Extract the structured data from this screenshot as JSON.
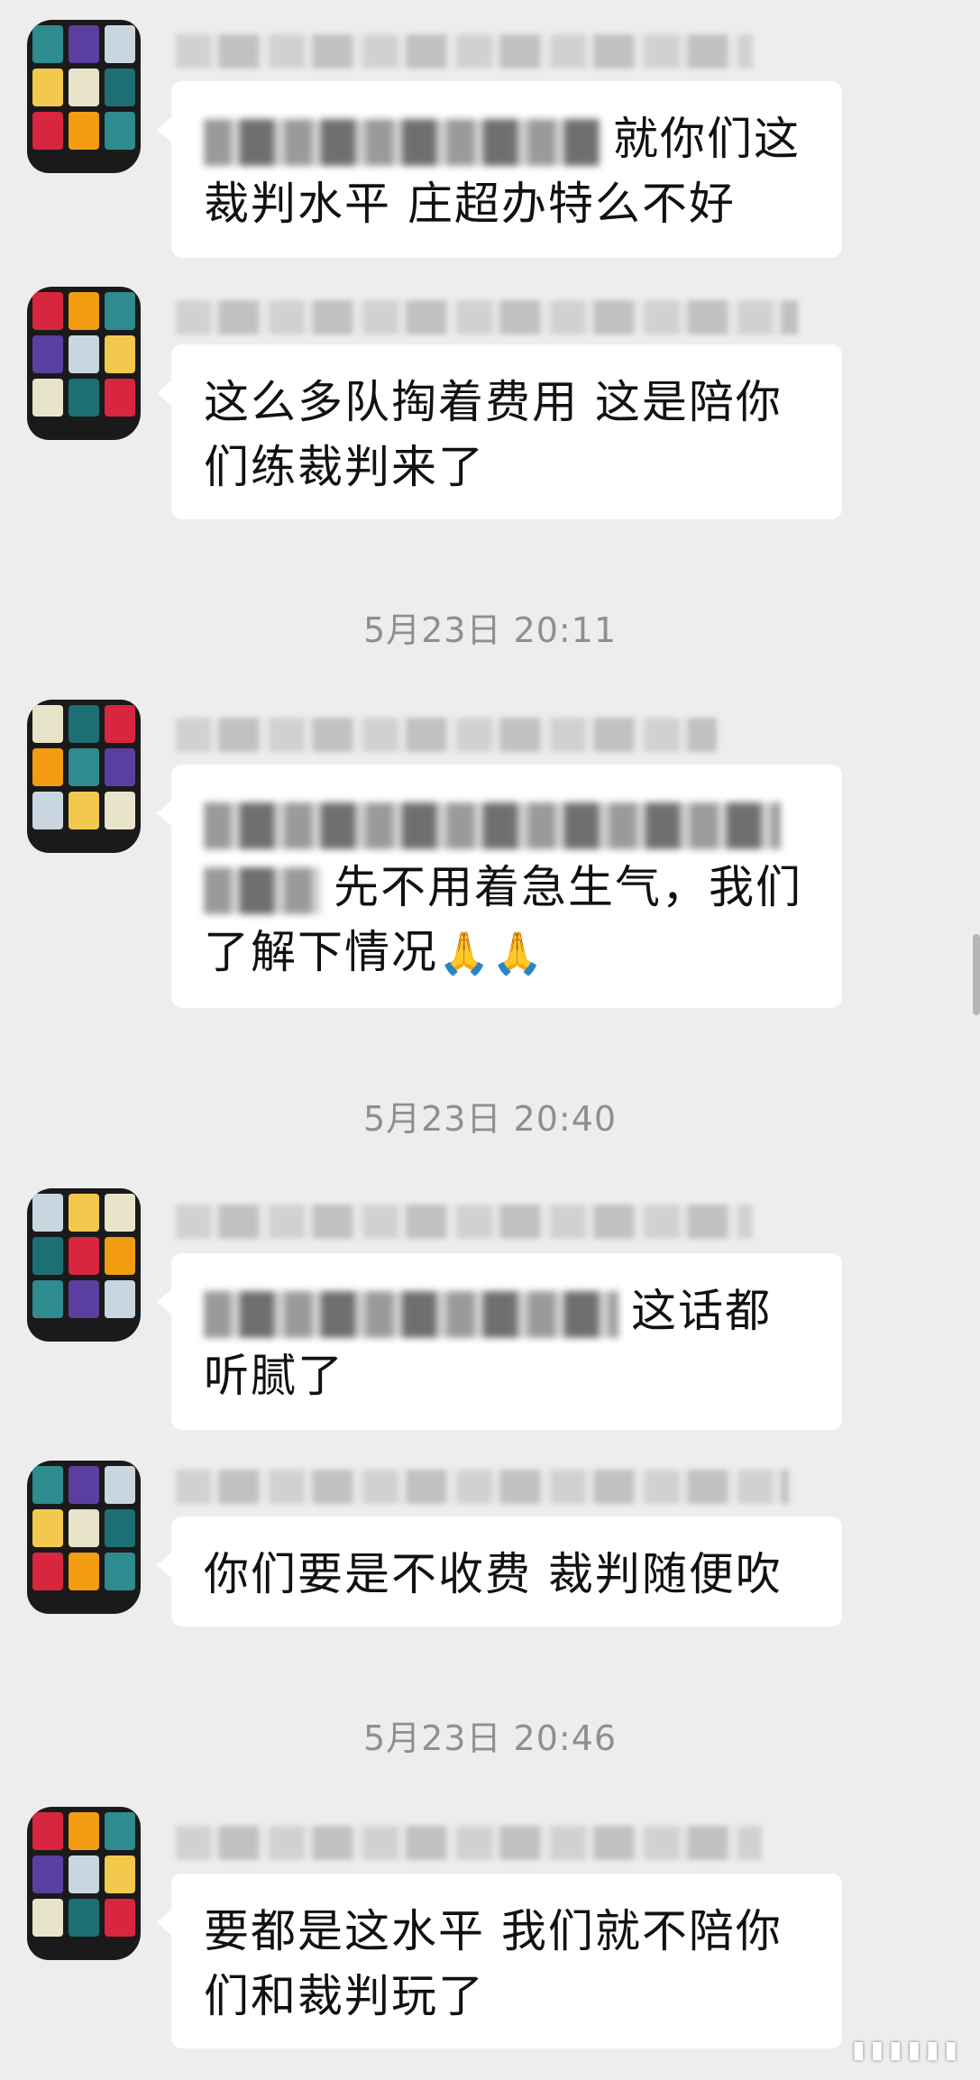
{
  "colors": {
    "background": "#ededed",
    "bubble": "#ffffff",
    "timestamp": "#8f8f8f"
  },
  "avatar_palette": [
    "#2e8b8f",
    "#f2c94c",
    "#d7263d",
    "#5b3fa0",
    "#e8e4c9",
    "#f39c12",
    "#c9d6df",
    "#1e6f73"
  ],
  "messages": [
    {
      "text": "就你们这裁判水平 庄超办特么不好"
    },
    {
      "text": "这么多队掏着费用 这是陪你们练裁判来了"
    },
    {
      "timestamp": "5月23日 20:11"
    },
    {
      "text": "先不用着急生气，我们了解下情况",
      "emoji": "🙏🙏"
    },
    {
      "timestamp": "5月23日 20:40"
    },
    {
      "text": "这话都听腻了"
    },
    {
      "text": "你们要是不收费 裁判随便吹"
    },
    {
      "timestamp": "5月23日 20:46"
    },
    {
      "text": "要都是这水平 我们就不陪你们和裁判玩了"
    }
  ]
}
